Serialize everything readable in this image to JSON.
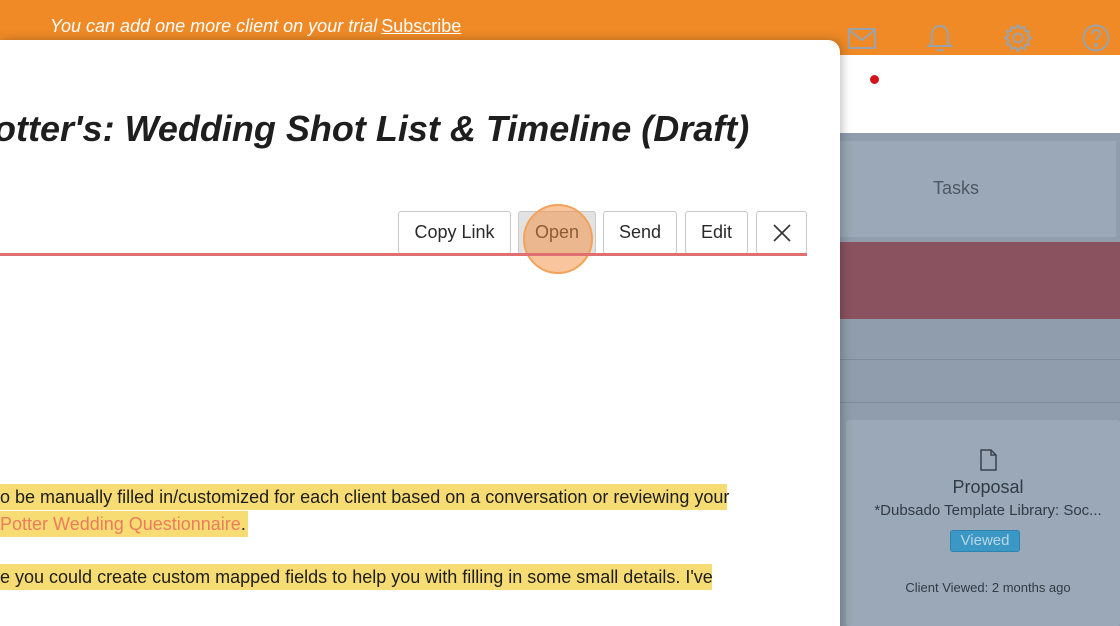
{
  "trial_banner": {
    "message": "You can add one more client on your trial",
    "subscribe_link": "Subscribe"
  },
  "topbar": {
    "icons": [
      "mail-icon",
      "bell-icon",
      "gear-icon",
      "help-icon"
    ],
    "mail_badge_color": "#d2131a"
  },
  "modal": {
    "title": "otter's: Wedding Shot List & Timeline (Draft)",
    "buttons": {
      "copy_link": "Copy Link",
      "open": "Open",
      "send": "Send",
      "edit": "Edit"
    },
    "body": {
      "line1": "o be manually filled in/customized for each client based on a conversation or reviewing your",
      "line2_link": "Potter Wedding Questionnaire",
      "line2_end": ".",
      "line3": "e you could create custom mapped fields to help you with filling in some small details. I've"
    }
  },
  "background": {
    "tasks_tab": "Tasks",
    "card": {
      "title": "Proposal",
      "subtitle": "*Dubsado Template Library: Soc...",
      "status": "Viewed",
      "footer": "Client Viewed: 2 months ago"
    }
  },
  "colors": {
    "banner": "#ef8a26",
    "highlight": "#f6dc72",
    "link": "#ec7c5e",
    "divider": "#e07070",
    "viewed_badge": "#3b97c4"
  }
}
